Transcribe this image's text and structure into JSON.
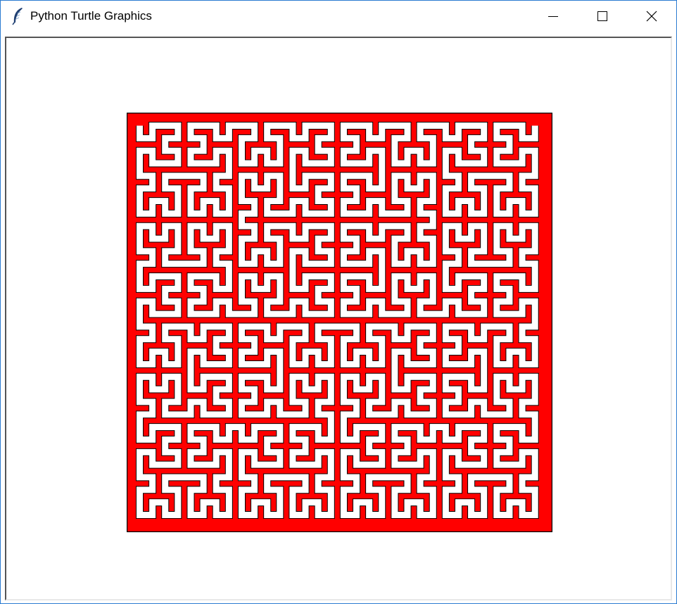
{
  "window": {
    "title": "Python Turtle Graphics",
    "app_icon": "feather-icon",
    "controls": [
      "minimize-icon",
      "maximize-icon",
      "close-icon"
    ]
  },
  "canvas": {
    "background": "#ffffff",
    "figure": {
      "shape": "Hilbert curve (filled)",
      "fill_color": "#ff0000",
      "stroke_color": "#000000"
    }
  }
}
